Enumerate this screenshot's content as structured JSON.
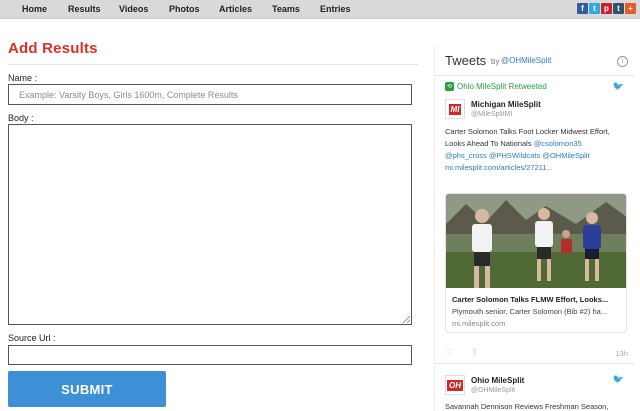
{
  "nav": {
    "items": [
      "Home",
      "Results",
      "Videos",
      "Photos",
      "Articles",
      "Teams",
      "Entries"
    ],
    "social": [
      {
        "icon": "facebook-icon",
        "glyph": "f",
        "color": "#3b5998"
      },
      {
        "icon": "twitter-icon",
        "glyph": "t",
        "color": "#2fa9e1"
      },
      {
        "icon": "pinterest-icon",
        "glyph": "p",
        "color": "#cb2027"
      },
      {
        "icon": "tumblr-icon",
        "glyph": "t",
        "color": "#34526f"
      },
      {
        "icon": "plus-icon",
        "glyph": "+",
        "color": "#e55a2a"
      }
    ]
  },
  "form": {
    "title": "Add Results",
    "name_label": "Name :",
    "name_placeholder": "Example: Varsity Boys, Girls 1600m, Complete Results",
    "body_label": "Body :",
    "source_label": "Source Url :",
    "submit_label": "SUBMIT"
  },
  "widget": {
    "title": "Tweets",
    "by": "by",
    "handle": "@OHMileSplit",
    "tweet1": {
      "retweet_text": "Ohio MileSplit Retweeted",
      "name": "Michigan MileSplit",
      "screen_name": "@MileSplitMI",
      "line1": "Carter Solomon Talks Foot Locker Midwest Effort,",
      "line2a": "Looks Ahead To Nationals ",
      "line2b": "@csolomon35",
      "line3a": "@phs_cross @PHSWildcats @OHMileSplit",
      "line4a": "mi.milesplit.com/articles/27211...",
      "card_title": "Carter Solomon Talks FLMW Effort, Looks...",
      "card_desc": "Plymouth senior, Carter Solomon (Bib #2) ha...",
      "card_domain": "mi.milesplit.com",
      "time": "13h"
    },
    "tweet2": {
      "name": "Ohio MileSplit",
      "screen_name": "@OHMileSplit",
      "line1": "Savannah Dennison Reviews Freshman Season,"
    }
  }
}
